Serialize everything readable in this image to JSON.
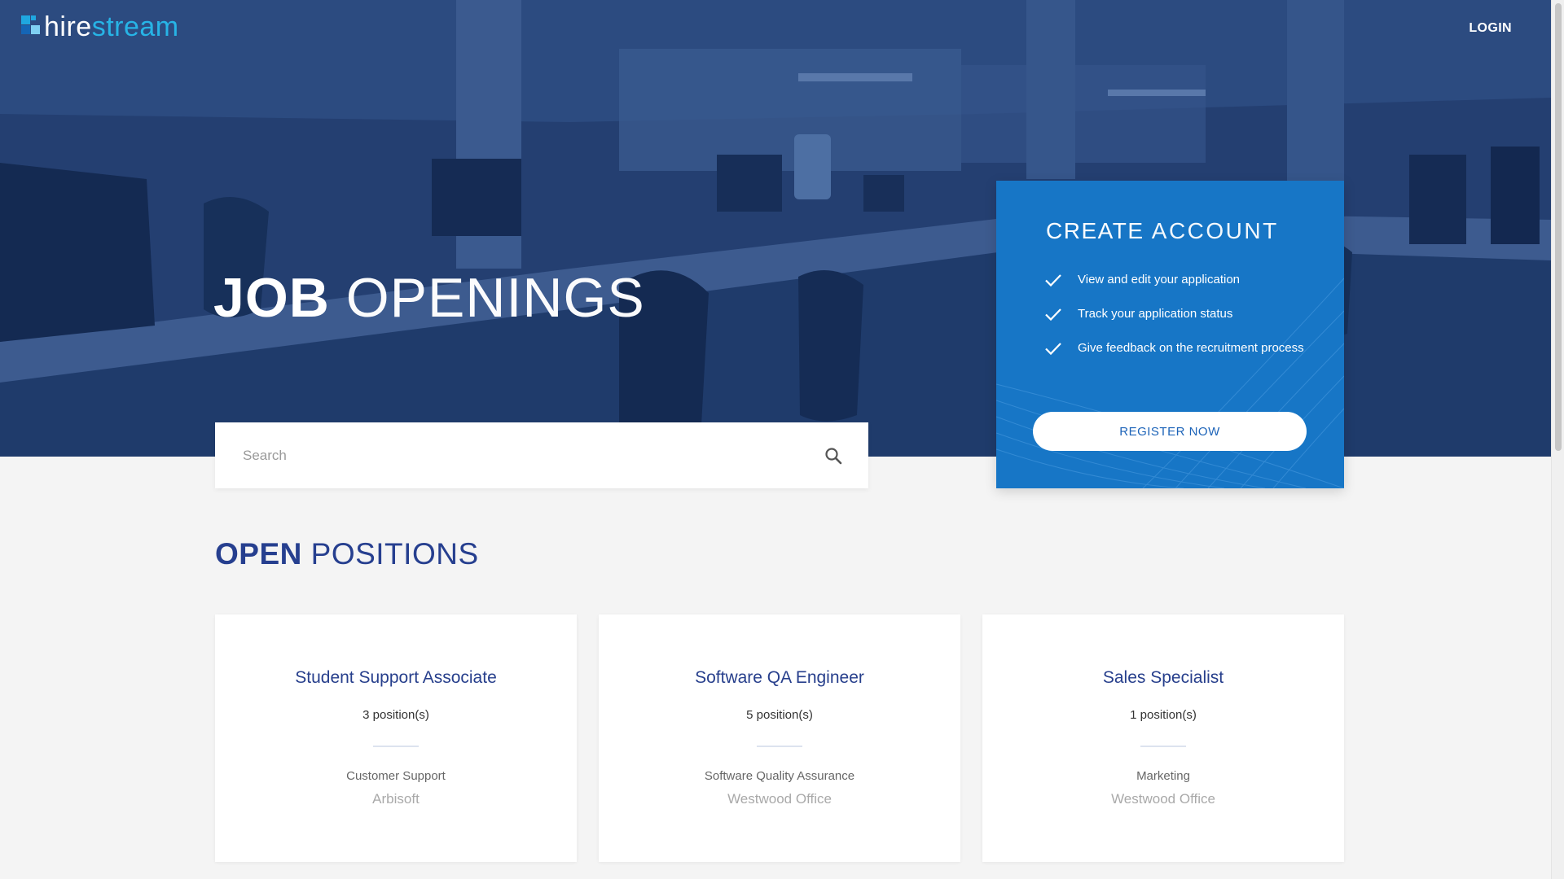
{
  "brand": {
    "name_part1": "hire",
    "name_part2": "stream",
    "mark_colors": [
      "#1fa7e0",
      "#1565b5",
      "#7fd0f2"
    ]
  },
  "header": {
    "login_label": "LOGIN"
  },
  "hero": {
    "title_strong": "JOB",
    "title_light": "OPENINGS"
  },
  "search": {
    "placeholder": "Search",
    "value": "",
    "icon": "search-icon"
  },
  "account": {
    "title_strong": "CREATE",
    "title_light": "ACCOUNT",
    "benefits": [
      "View and edit your application",
      "Track your application status",
      "Give feedback on the recruitment process"
    ],
    "register_label": "REGISTER NOW",
    "accent_color": "#1776c6"
  },
  "positions": {
    "title_strong": "OPEN",
    "title_light": "POSITIONS",
    "jobs": [
      {
        "title": "Student Support Associate",
        "count": "3 position(s)",
        "department": "Customer Support",
        "location": "Arbisoft"
      },
      {
        "title": "Software QA Engineer",
        "count": "5 position(s)",
        "department": "Software Quality Assurance",
        "location": "Westwood Office"
      },
      {
        "title": "Sales Specialist",
        "count": "1 position(s)",
        "department": "Marketing",
        "location": "Westwood Office"
      }
    ]
  },
  "colors": {
    "heading_blue": "#263f8f",
    "hero_overlay": "#213f72"
  }
}
